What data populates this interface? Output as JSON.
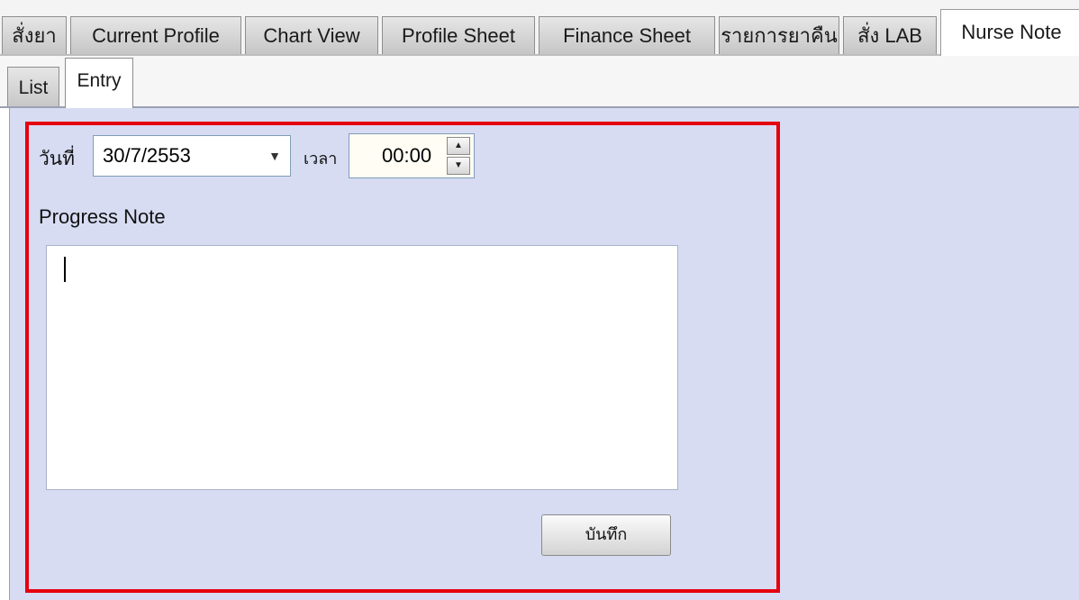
{
  "top_tabs": [
    {
      "label": "สั่งยา"
    },
    {
      "label": "Current Profile"
    },
    {
      "label": "Chart View"
    },
    {
      "label": "Profile Sheet"
    },
    {
      "label": "Finance Sheet"
    },
    {
      "label": "รายการยาคืน"
    },
    {
      "label": "สั่ง LAB"
    },
    {
      "label": "Nurse Note",
      "active": true
    }
  ],
  "sub_tabs": [
    {
      "label": "List"
    },
    {
      "label": "Entry",
      "active": true
    }
  ],
  "form": {
    "date_label": "วันที่",
    "date_value": "30/7/2553",
    "time_label": "เวลา",
    "time_value": "00:00",
    "progress_note_label": "Progress Note",
    "progress_note_value": "",
    "save_label": "บันทึก"
  },
  "colors": {
    "panel_background": "#d7dcf3",
    "highlight_border": "#e5000f"
  },
  "icons": {
    "date_dropdown": "chevron-down-icon",
    "spin_up": "spin-up-icon",
    "spin_down": "spin-down-icon"
  }
}
